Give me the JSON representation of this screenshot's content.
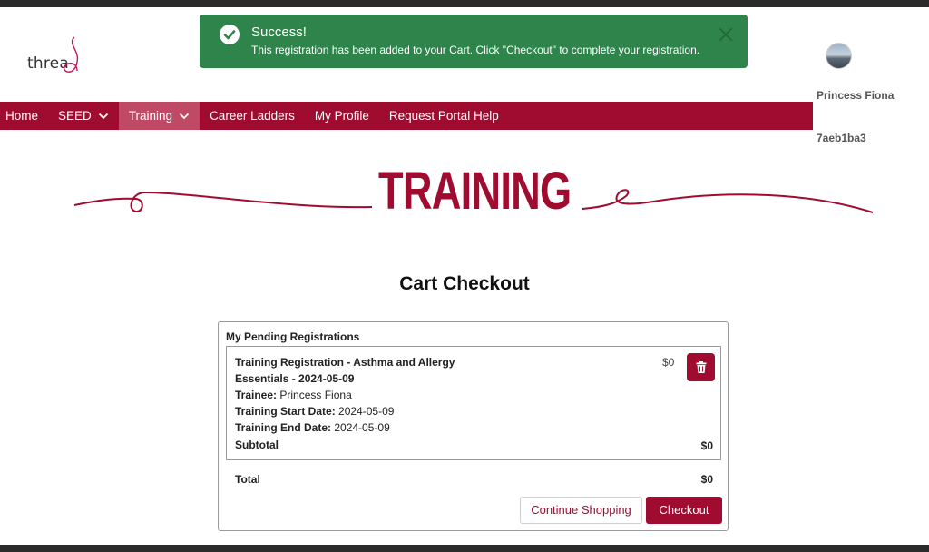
{
  "brand": {
    "logo_text": "threa",
    "accent": "#a00c30"
  },
  "toast": {
    "title": "Success!",
    "message": "This registration has been added to your Cart. Click \"Checkout\" to complete your registration.",
    "icon": "check-circle-icon",
    "close_icon": "close-icon",
    "color": "#2e844a"
  },
  "user": {
    "name": "Princess Fiona",
    "id": "7aeb1ba3"
  },
  "nav": {
    "items": [
      {
        "label": "Home"
      },
      {
        "label": "SEED"
      },
      {
        "label": "Training"
      },
      {
        "label": "Career Ladders"
      },
      {
        "label": "My Profile"
      },
      {
        "label": "Request Portal Help"
      }
    ]
  },
  "banner": {
    "title": "TRAINING"
  },
  "page": {
    "title": "Cart Checkout"
  },
  "cart": {
    "heading": "My Pending Registrations",
    "registration": {
      "title_line1": "Training Registration - Asthma and Allergy",
      "title_line2": "Essentials - 2024-05-09",
      "price": "$0",
      "trainee_label": "Trainee:",
      "trainee": "Princess Fiona",
      "start_label": "Training Start Date:",
      "start": "2024-05-09",
      "end_label": "Training End Date:",
      "end": "2024-05-09",
      "subtotal_label": "Subtotal",
      "subtotal": "$0",
      "delete_icon": "trash-icon"
    },
    "total_label": "Total",
    "total": "$0",
    "continue_label": "Continue Shopping",
    "checkout_label": "Checkout"
  }
}
